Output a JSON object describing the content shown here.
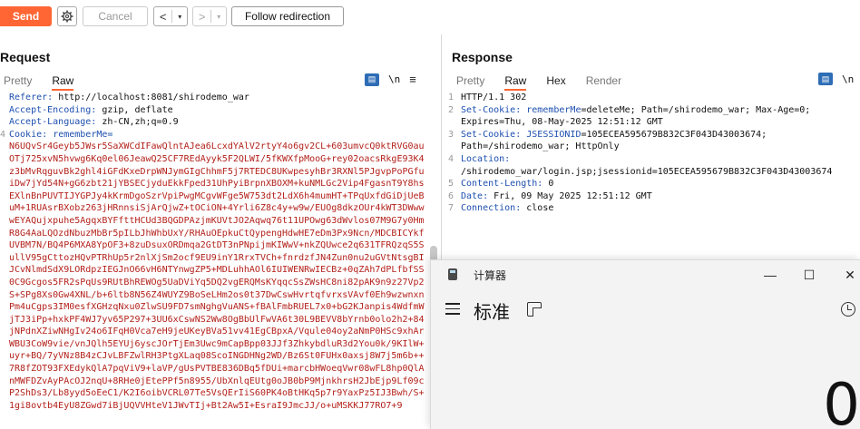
{
  "toolbar": {
    "send_label": "Send",
    "cancel_label": "Cancel",
    "back_arrow": "<",
    "fwd_arrow": ">",
    "caret": "▾",
    "follow_label": "Follow redirection"
  },
  "request": {
    "title": "Request",
    "tabs": [
      "Pretty",
      "Raw"
    ],
    "active_tab": "Raw",
    "newline_label": "\\n",
    "menu_label": "≡",
    "line_number": "4",
    "lines": [
      {
        "key": "Referer:",
        "value": " http://localhost:8081/shirodemo_war"
      },
      {
        "key": "Accept-Encoding:",
        "value": " gzip, deflate"
      },
      {
        "key": "Accept-Language:",
        "value": " zh-CN,zh;q=0.9"
      },
      {
        "key": "Cookie:",
        "value": " ",
        "cookie_name": "rememberMe="
      }
    ],
    "cookie_value": "N6UQvSr4Geyb5JWsr5SaXWCdIFawQlntAJea6LcxdYAlV2rtyY4o6gv2CL+603umvcQ0ktRVG0auOTj725xvN5hvwg6Kq0el06JeawQ25CF7REdAyyk5F2QLWI/5fKWXfpMooG+rey02oacsRkgE93K4z3bMvRqguvBk2ghl4iGFdKxeDrpWNJymGIgChhmF5j7RTEDC8UKwpesyhBr3RXNl5PJgvpPoPGfuiDw7jYd54N+gG6zbt21jYBSECjyduEkkFped31UhPyiBrpnXBOXM+kuNMLGc2Vip4FgasnT9Y8hsEXlnBnPUVTIJYGPJy4kKrmDgoSzrVpiPwgMCgvWFge5W753dt2LdX6h4mumHT+TPqUxfdGiDjUeBuM+1RUAsrBXobz263jHRnnsiSjArQjwZ+tOCiON+4Yrli6Z8c4y+w9w/EUOg8dkzOUr4kWT3DWwwwEYAQujxpuhe5AgqxBYFfttHCUd3BQGDPAzjmKUVtJO2Aqwq76t11UPOwg63dWvlos07M9G7y0HmR8G4AaLQOzdNbuzMbBr5pILbJhWhbUxY/RHAuOEpkuCtQypengHdwHE7eDm3Px9Ncn/MDCBICYkfUVBM7N/BQ4P6MXA8YpOF3+8zuDsuxORDmqa2GtDT3nPNpijmKIWwV+nkZQUwce2q631TFRQzqS5SullV95gCttozHQvPTRhUp5r2nlXjSm2ocf9EU9inY1RrxTVCh+fnrdzfJN4Zun0nu2uGVtNtsgBIJCvNlmdSdX9LORdpzIEGJnO66vH6NTYnwgZP5+MDLuhhAOl6IUIWENRwIECBz+0qZAh7dPLfbfSS0C9Gcgos5FR2sPqUs9RUtBhREWOg5UaDViYq5DQ2vgERQMsKYqqcSsZWsHC8ni82pAK9n9z27Vp2S+SPg8Xs0Gw4XNL/b+6ltb8N56Z4WUYZ9BoSeLHm2os0t37DwCswHvrtqfvrxsVAvf0Eh9wzwnxnPm4uCgps3IM0esfXGHzqNxu0ZlwSU9FD7smNghgVuANS+fBAlFmbRUEL7x0+bG2KJanpis4WdfmWjTJ3iPp+hxkPF4WJ7yv65P297+3UU6xCswNS2Ww8OgBbUlFwVA6t30L9BEVV8bYrnb0olo2h2+84jNPdnXZiwNHgIv24o6IFqH0Vca7eH9jeUKeyBVa51vv41EgCBpxA/Vqule04oy2aNmP0HSc9xhArWBU3CoW9vie/vnJQlh5EYUj6yscJOrTjEm3Uwc9mCapBpp03JJf3ZhkybdluR3d2You0k/9KIlW+uyr+BQ/7yVNz8B4zCJvLBFZwlRH3PtgXLaq08ScoINGDHNg2WD/Bz6St0FUHx0axsj8W7j5m6b++7R8fZOT93FXEdykQlA7pqViV9+laVP/gUsPVTBE836DBq5fDUi+marcbHWoeqVwr08wFL8hp0QlAnMWFDZvAyPAcOJ2nqU+8RHe0jEtePPf5n8955/UbXnlqEUtg0oJB0bP9MjnkhrsH2JbEjp9Lf09cP2ShDs3/Lb8yyd5oEeC1/K2I6oibVCRL07Te5VsQErIiS60PK4oBtHKq5p7r9YaxPz5IJ3Bwh/S+1gi8ovtb4EyU8ZGwd7iBjUQVVHteV1JWvTIj+Bt2Aw5I+EsraI9JmcJJ/o+uMSKKJ77RO7+9"
  },
  "response": {
    "title": "Response",
    "tabs": [
      "Pretty",
      "Raw",
      "Hex",
      "Render"
    ],
    "active_tab": "Raw",
    "newline_label": "\\n",
    "menu_label": "≡",
    "lines": [
      {
        "num": "1",
        "segments": [
          {
            "t": "HTTP/1.1 302",
            "c": "plain"
          }
        ]
      },
      {
        "num": "2",
        "segments": [
          {
            "t": "Set-Cookie:",
            "c": "key"
          },
          {
            "t": " rememberMe",
            "c": "blue"
          },
          {
            "t": "=deleteMe; Path=/shirodemo_war; Max-Age=0;\nExpires=Thu, 08-May-2025 12:51:12 GMT",
            "c": "plain"
          }
        ]
      },
      {
        "num": "3",
        "segments": [
          {
            "t": "Set-Cookie:",
            "c": "key"
          },
          {
            "t": " JSESSIONID",
            "c": "blue"
          },
          {
            "t": "=105ECEA595679B832C3F043D43003674;\nPath=/shirodemo_war; HttpOnly",
            "c": "plain"
          }
        ]
      },
      {
        "num": "4",
        "segments": [
          {
            "t": "Location:",
            "c": "key"
          },
          {
            "t": "\n/shirodemo_war/login.jsp;jsessionid=105ECEA595679B832C3F043D43003674",
            "c": "plain"
          }
        ]
      },
      {
        "num": "5",
        "segments": [
          {
            "t": "Content-Length:",
            "c": "key"
          },
          {
            "t": " 0",
            "c": "plain"
          }
        ]
      },
      {
        "num": "6",
        "segments": [
          {
            "t": "Date:",
            "c": "key"
          },
          {
            "t": " Fri, 09 May 2025 12:51:12 GMT",
            "c": "plain"
          }
        ]
      },
      {
        "num": "7",
        "segments": [
          {
            "t": "Connection:",
            "c": "key"
          },
          {
            "t": " close",
            "c": "plain"
          }
        ]
      }
    ]
  },
  "calculator": {
    "window_title": "计算器",
    "mode": "标准",
    "display": "0",
    "min_label": "—",
    "max_label": "☐",
    "close_label": "✕"
  }
}
